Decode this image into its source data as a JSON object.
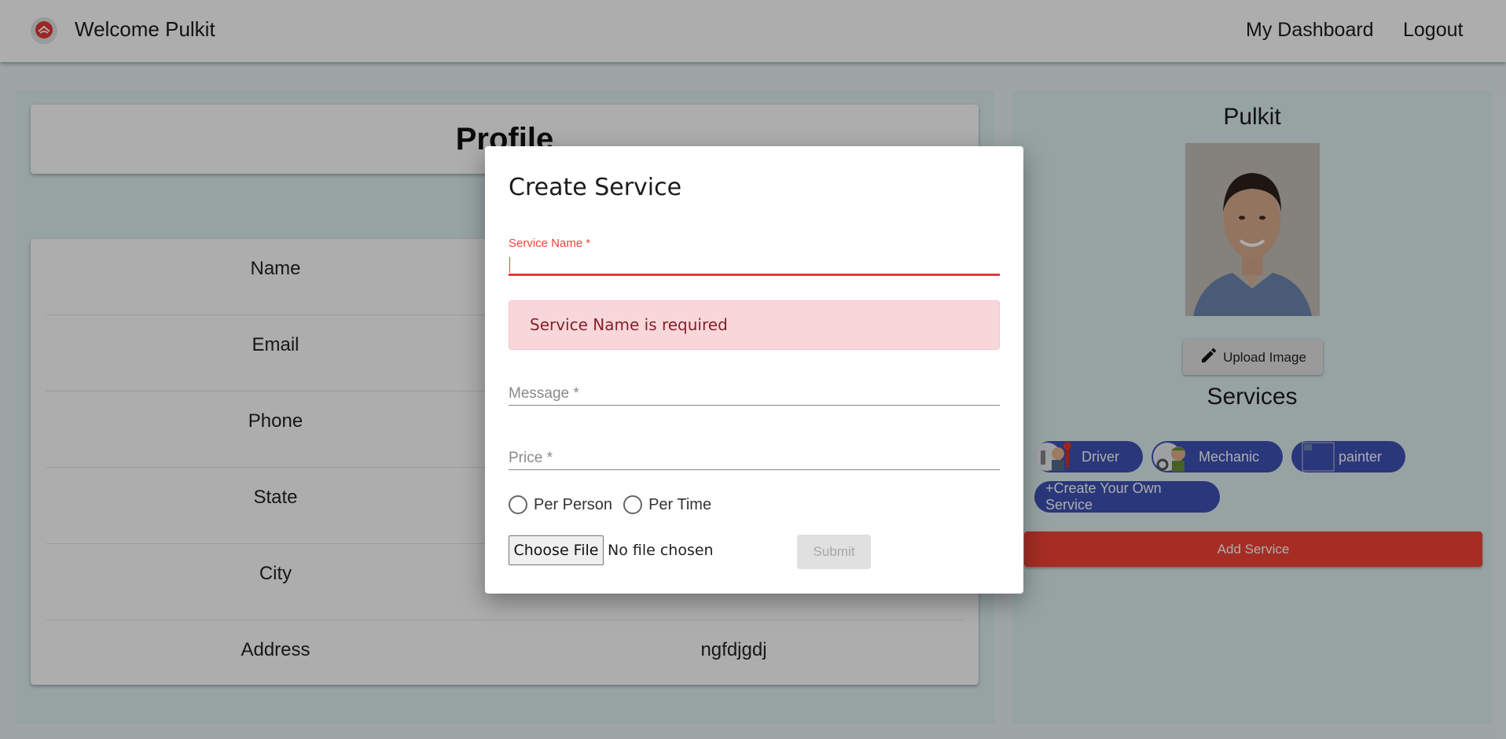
{
  "header": {
    "welcome_text": "Welcome Pulkit",
    "nav": {
      "dashboard": "My Dashboard",
      "logout": "Logout"
    }
  },
  "profile": {
    "title": "Profile",
    "rows": [
      {
        "label": "Name",
        "value": ""
      },
      {
        "label": "Email",
        "value": ""
      },
      {
        "label": "Phone",
        "value": ""
      },
      {
        "label": "State",
        "value": ""
      },
      {
        "label": "City",
        "value": ""
      },
      {
        "label": "Address",
        "value": "ngfdjgdj"
      }
    ]
  },
  "sidebar": {
    "user_name": "Pulkit",
    "upload_label": "Upload Image",
    "services_title": "Services",
    "service_chips": [
      "Driver",
      "Mechanic",
      "painter"
    ],
    "create_chip_label": "+Create Your Own Service",
    "add_service_label": "Add Service"
  },
  "dialog": {
    "title": "Create Service",
    "service_name": {
      "label": "Service Name *",
      "value": ""
    },
    "error_message": "Service Name is required",
    "message_field": {
      "placeholder": "Message *",
      "value": ""
    },
    "price_field": {
      "placeholder": "Price *",
      "value": ""
    },
    "pricing_options": [
      "Per Person",
      "Per Time"
    ],
    "file_button_label": "Choose File",
    "file_status": "No file chosen",
    "submit_label": "Submit"
  },
  "colors": {
    "accent_red": "#f44336",
    "chip_blue": "#3f51b5",
    "alert_bg": "#f8d7da",
    "alert_text": "#842029"
  }
}
